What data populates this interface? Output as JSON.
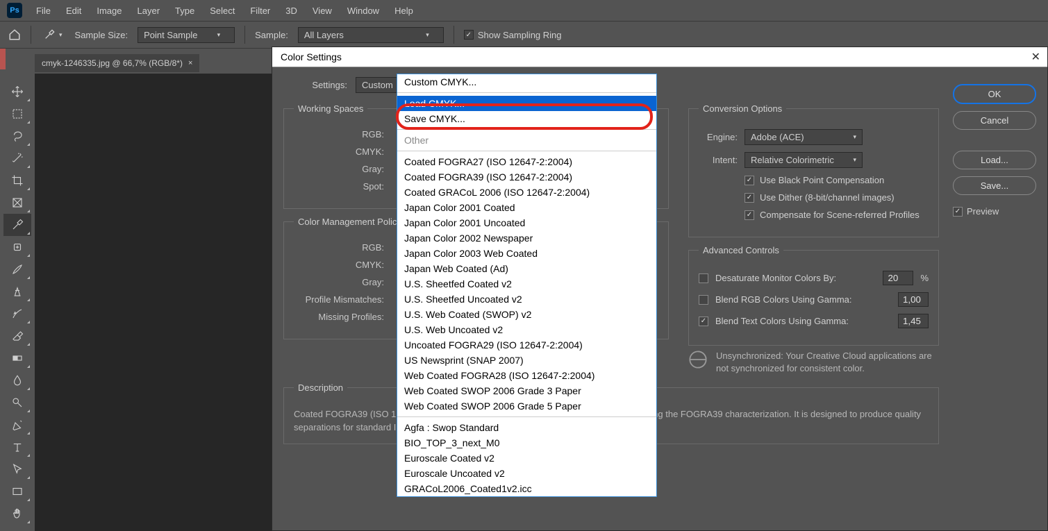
{
  "app": {
    "logo": "Ps"
  },
  "menu": [
    "File",
    "Edit",
    "Image",
    "Layer",
    "Type",
    "Select",
    "Filter",
    "3D",
    "View",
    "Window",
    "Help"
  ],
  "options": {
    "sample_size_label": "Sample Size:",
    "sample_size_value": "Point Sample",
    "sample_label": "Sample:",
    "sample_value": "All Layers",
    "show_ring": "Show Sampling Ring"
  },
  "doc_tab": {
    "title": "cmyk-1246335.jpg @ 66,7% (RGB/8*)"
  },
  "tools": [
    {
      "name": "move-tool"
    },
    {
      "name": "marquee-tool"
    },
    {
      "name": "lasso-tool"
    },
    {
      "name": "magic-wand-tool"
    },
    {
      "name": "crop-tool"
    },
    {
      "name": "frame-tool"
    },
    {
      "name": "eyedropper-tool",
      "active": true
    },
    {
      "name": "healing-brush-tool"
    },
    {
      "name": "brush-tool"
    },
    {
      "name": "clone-stamp-tool"
    },
    {
      "name": "history-brush-tool"
    },
    {
      "name": "eraser-tool"
    },
    {
      "name": "gradient-tool"
    },
    {
      "name": "blur-tool"
    },
    {
      "name": "dodge-tool"
    },
    {
      "name": "pen-tool"
    },
    {
      "name": "type-tool"
    },
    {
      "name": "path-selection-tool"
    },
    {
      "name": "rectangle-tool"
    },
    {
      "name": "hand-tool"
    }
  ],
  "dialog": {
    "title": "Color Settings",
    "settings_label": "Settings:",
    "settings_value": "Custom",
    "ws": {
      "title": "Working Spaces",
      "rgb": "RGB:",
      "cmyk": "CMYK:",
      "gray": "Gray:",
      "spot": "Spot:"
    },
    "cmp": {
      "title": "Color Management Policies",
      "rgb": "RGB:",
      "cmyk": "CMYK:",
      "gray": "Gray:",
      "mismatch": "Profile Mismatches:",
      "missing": "Missing Profiles:"
    },
    "conv": {
      "title": "Conversion Options",
      "engine_label": "Engine:",
      "engine_value": "Adobe (ACE)",
      "intent_label": "Intent:",
      "intent_value": "Relative Colorimetric",
      "bpc": "Use Black Point Compensation",
      "dither": "Use Dither (8-bit/channel images)",
      "scene": "Compensate for Scene-referred Profiles"
    },
    "adv": {
      "title": "Advanced Controls",
      "desat": "Desaturate Monitor Colors By:",
      "desat_val": "20",
      "pct": "%",
      "blend_rgb": "Blend RGB Colors Using Gamma:",
      "blend_rgb_val": "1,00",
      "blend_text": "Blend Text Colors Using Gamma:",
      "blend_text_val": "1,45"
    },
    "sync": "Unsynchronized: Your Creative Cloud applications are not synchronized for consistent color.",
    "desc": {
      "title": "Description",
      "text": "Coated FOGRA39 (ISO 12647-2:2004): Offset printing according to ISO 12647-2:2004 using the FOGRA39 characterization. It is designed to produce quality separations for standard ISO printing using Process Standard Offset on coated paper."
    },
    "buttons": {
      "ok": "OK",
      "cancel": "Cancel",
      "load": "Load...",
      "save": "Save...",
      "preview": "Preview"
    }
  },
  "dropdown": {
    "custom": "Custom CMYK...",
    "load": "Load CMYK...",
    "save": "Save CMYK...",
    "other": "Other",
    "group1": [
      "Coated FOGRA27 (ISO 12647-2:2004)",
      "Coated FOGRA39 (ISO 12647-2:2004)",
      "Coated GRACoL 2006 (ISO 12647-2:2004)",
      "Japan Color 2001 Coated",
      "Japan Color 2001 Uncoated",
      "Japan Color 2002 Newspaper",
      "Japan Color 2003 Web Coated",
      "Japan Web Coated (Ad)",
      "U.S. Sheetfed Coated v2",
      "U.S. Sheetfed Uncoated v2",
      "U.S. Web Coated (SWOP) v2",
      "U.S. Web Uncoated v2",
      "Uncoated FOGRA29 (ISO 12647-2:2004)",
      "US Newsprint (SNAP 2007)",
      "Web Coated FOGRA28 (ISO 12647-2:2004)",
      "Web Coated SWOP 2006 Grade 3 Paper",
      "Web Coated SWOP 2006 Grade 5 Paper"
    ],
    "group2": [
      "Agfa : Swop Standard",
      "BIO_TOP_3_next_M0",
      "Euroscale Coated v2",
      "Euroscale Uncoated v2",
      "GRACoL2006_Coated1v2.icc"
    ]
  }
}
